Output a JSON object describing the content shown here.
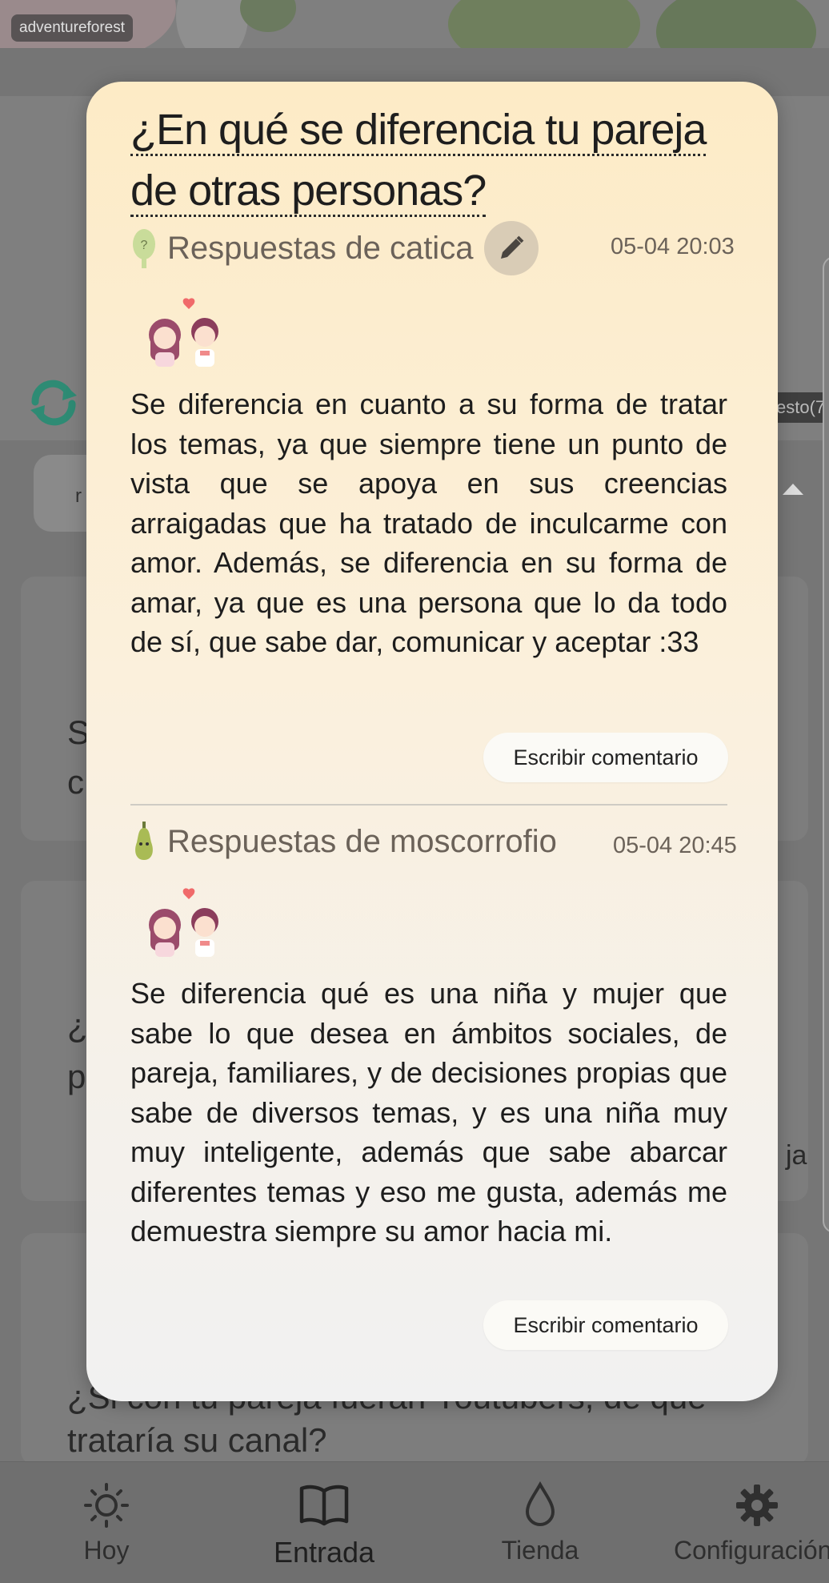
{
  "background": {
    "forest_tag": "adventureforest",
    "pill_text": "r",
    "badge_text": "esto(7",
    "card_texts": [
      {
        "line1": "S",
        "line2": "c"
      },
      {
        "line1": "¿I",
        "line2": "p"
      },
      {
        "line1": "¿Si con tu pareja fueran Youtubers, de qué",
        "line2": "trataría su canal?"
      }
    ],
    "side_fragment": "ja"
  },
  "modal": {
    "question_line1": "¿En qué se diferencia tu pareja",
    "question_line2": "de otras personas?",
    "responses": [
      {
        "author": "Respuestas de catica",
        "time": "05-04 20:03",
        "answer": "Se diferencia en cuanto a su forma de tratar los temas, ya que siempre tiene un punto de vista que se apoya en sus creencias arraigadas que ha tratado de inculcarme con amor. Además, se diferencia en su forma de amar, ya que es una persona que lo da todo de sí, que sabe dar, comunicar y aceptar :33",
        "comment_label": "Escribir comentario",
        "avatar_icon": "tree-question-icon"
      },
      {
        "author": "Respuestas de moscorrofio",
        "time": "05-04 20:45",
        "answer": "Se diferencia qué es una niña y mujer que sabe lo que desea en ámbitos sociales, de pareja, familiares, y de decisiones propias que sabe de diversos temas, y es una niña muy muy inteligente, además que sabe abarcar diferentes temas y eso me gusta, además me demuestra siempre su amor hacia mi.",
        "comment_label": "Escribir comentario",
        "avatar_icon": "pear-character-icon"
      }
    ]
  },
  "nav": {
    "items": [
      {
        "label": "Hoy",
        "icon": "sun-icon"
      },
      {
        "label": "Entrada",
        "icon": "book-icon"
      },
      {
        "label": "Tienda",
        "icon": "drop-icon"
      },
      {
        "label": "Configuración",
        "icon": "gear-icon"
      }
    ],
    "active": "Entrada"
  },
  "colors": {
    "modal_top": "#fdebc6",
    "modal_bottom": "#f1f1f1",
    "text_muted": "#6b6259",
    "refresh_green": "#2e8b74"
  }
}
